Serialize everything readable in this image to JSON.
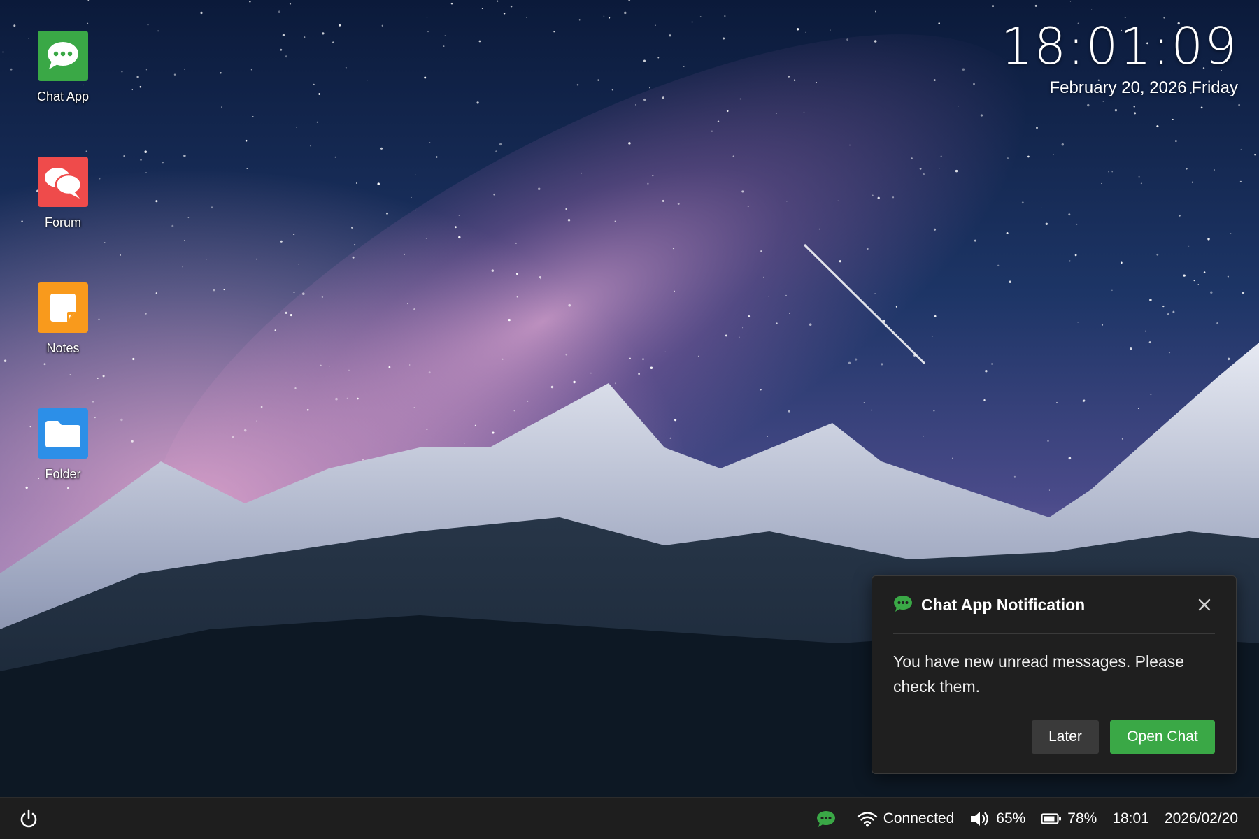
{
  "desktop": {
    "icons": [
      {
        "label": "Chat App",
        "icon": "chat-bubble-icon",
        "color": "#3aa846"
      },
      {
        "label": "Forum",
        "icon": "forum-bubbles-icon",
        "color": "#ef4b4b"
      },
      {
        "label": "Notes",
        "icon": "sticky-note-icon",
        "color": "#f99a1c"
      },
      {
        "label": "Folder",
        "icon": "folder-icon",
        "color": "#2c8fe8"
      }
    ]
  },
  "clock": {
    "time": "18:01:09",
    "date": "February 20, 2026 Friday"
  },
  "notification": {
    "title": "Chat App Notification",
    "message": "You have new unread messages. Please check them.",
    "later_label": "Later",
    "open_label": "Open Chat",
    "accent": "#3aa846"
  },
  "taskbar": {
    "wifi_status": "Connected",
    "volume": "65%",
    "battery": "78%",
    "time": "18:01",
    "date": "2026/02/20"
  }
}
